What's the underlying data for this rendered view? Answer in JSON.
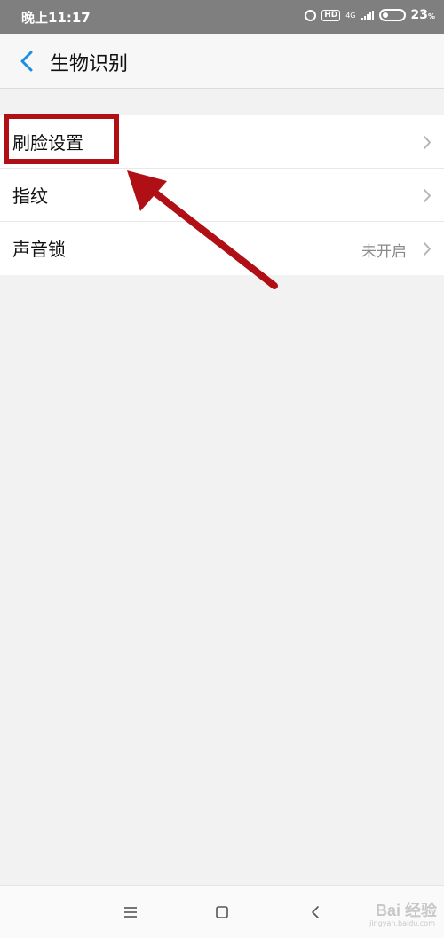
{
  "status_bar": {
    "time": "晚上11:17",
    "network": "4G",
    "hd": "HD",
    "battery": "23",
    "battery_unit": "%"
  },
  "header": {
    "title": "生物识别",
    "back_icon": "chevron-left-icon"
  },
  "settings": {
    "items": [
      {
        "label": "刷脸设置",
        "value": ""
      },
      {
        "label": "指纹",
        "value": ""
      },
      {
        "label": "声音锁",
        "value": "未开启"
      }
    ]
  },
  "nav_bar": {
    "menu_icon": "menu-icon",
    "home_icon": "square-home-icon",
    "back_icon": "triangle-back-icon"
  },
  "watermark": {
    "text": "Bai 经验",
    "sub": "jingyan.baidu.com"
  },
  "colors": {
    "accent": "#1a8ee0",
    "annotation": "#b10f16",
    "status_bar": "#7f7f7f",
    "background": "#f2f2f2"
  }
}
